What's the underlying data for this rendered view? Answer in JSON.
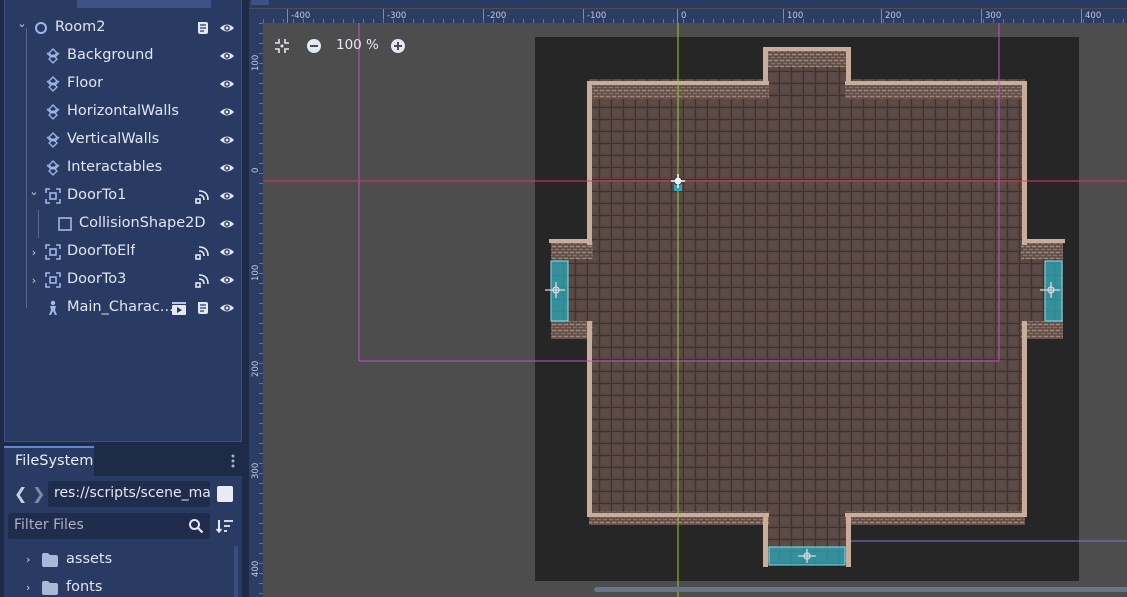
{
  "scene_tree": {
    "nodes": [
      {
        "label": "Room2",
        "depth": 0,
        "expanded": true,
        "icon": "node2d-circle-icon",
        "extras": [
          "script-icon"
        ]
      },
      {
        "label": "Background",
        "depth": 1,
        "icon": "tilemap-icon",
        "extras": []
      },
      {
        "label": "Floor",
        "depth": 1,
        "icon": "tilemap-icon",
        "extras": []
      },
      {
        "label": "HorizontalWalls",
        "depth": 1,
        "icon": "tilemap-icon",
        "extras": []
      },
      {
        "label": "VerticalWalls",
        "depth": 1,
        "icon": "tilemap-icon",
        "extras": []
      },
      {
        "label": "Interactables",
        "depth": 1,
        "icon": "tilemap-icon",
        "extras": []
      },
      {
        "label": "DoorTo1",
        "depth": 1,
        "expanded": true,
        "icon": "area2d-icon",
        "extras": [
          "signals-icon"
        ]
      },
      {
        "label": "CollisionShape2D",
        "depth": 2,
        "icon": "collision-shape-icon",
        "extras": []
      },
      {
        "label": "DoorToElf",
        "depth": 1,
        "expanded": false,
        "icon": "area2d-icon",
        "extras": [
          "signals-icon"
        ]
      },
      {
        "label": "DoorTo3",
        "depth": 1,
        "expanded": false,
        "icon": "area2d-icon",
        "extras": [
          "signals-icon"
        ]
      },
      {
        "label": "Main_Charac...",
        "depth": 1,
        "icon": "character-body-icon",
        "extras": [
          "instance-icon",
          "script-icon"
        ]
      }
    ]
  },
  "filesystem": {
    "tab_label": "FileSystem",
    "path": "res://scripts/scene_ma",
    "filter_placeholder": "Filter Files",
    "items": [
      {
        "label": "assets"
      },
      {
        "label": "fonts"
      }
    ]
  },
  "viewport": {
    "zoom_label": "100 %",
    "ruler_top": [
      "-400",
      "-300",
      "-200",
      "-100",
      "0",
      "100",
      "200",
      "300",
      "400"
    ],
    "ruler_left": [
      "100",
      "0",
      "100",
      "200",
      "300",
      "400"
    ],
    "colors": {
      "background": "#4d4d4d",
      "room_bg": "#262626",
      "floor": "#564641",
      "wall": "#b39a8a",
      "door_zone": "#2aa7b8",
      "axis_x": "#e03a5a",
      "axis_y": "#9acd32",
      "camera": "#c050c8"
    }
  }
}
